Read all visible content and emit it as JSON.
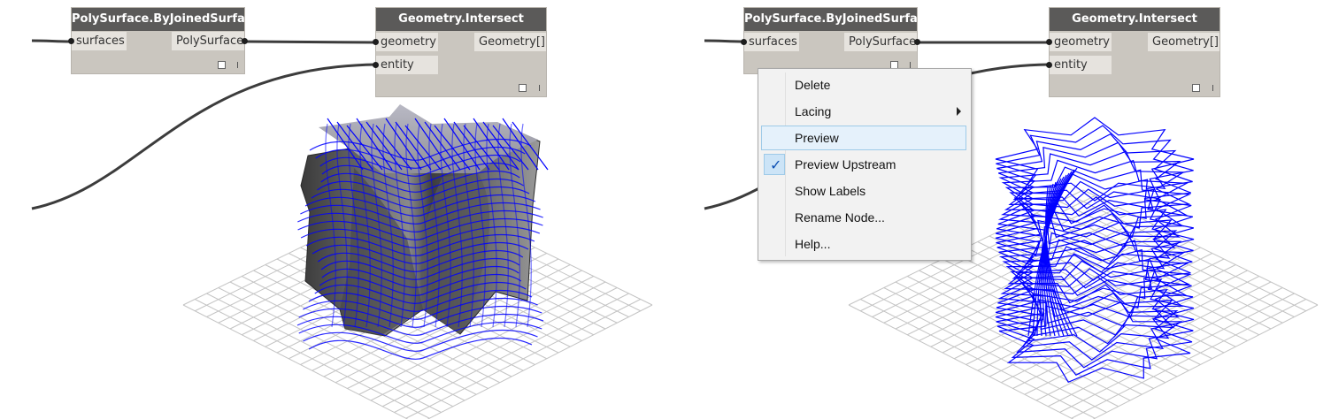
{
  "nodes": {
    "polysurface": {
      "title": "PolySurface.ByJoinedSurfaces",
      "input": "surfaces",
      "output": "PolySurface"
    },
    "intersect": {
      "title": "Geometry.Intersect",
      "input_geometry": "geometry",
      "input_entity": "entity",
      "output": "Geometry[]"
    }
  },
  "context_menu": {
    "items": [
      {
        "label": "Delete"
      },
      {
        "label": "Lacing",
        "submenu": true
      },
      {
        "label": "Preview",
        "state": "hover"
      },
      {
        "label": "Preview Upstream",
        "checked": true
      },
      {
        "label": "Show Labels"
      },
      {
        "label": "Rename Node..."
      },
      {
        "label": "Help..."
      }
    ]
  },
  "colors": {
    "node_title_bg": "#5b5a59",
    "node_body": "#cac6bf",
    "port_bg": "#e6e3de",
    "wire": "#3c3c3c",
    "section_lines": "#0000ff",
    "grid": "#c4c4c4",
    "menu_bg": "#f2f2f2",
    "menu_hover": "#e5f1fb",
    "check": "#0b4fb3"
  },
  "icons": {
    "check": "check-mark-icon",
    "submenu": "chevron-right-icon"
  }
}
